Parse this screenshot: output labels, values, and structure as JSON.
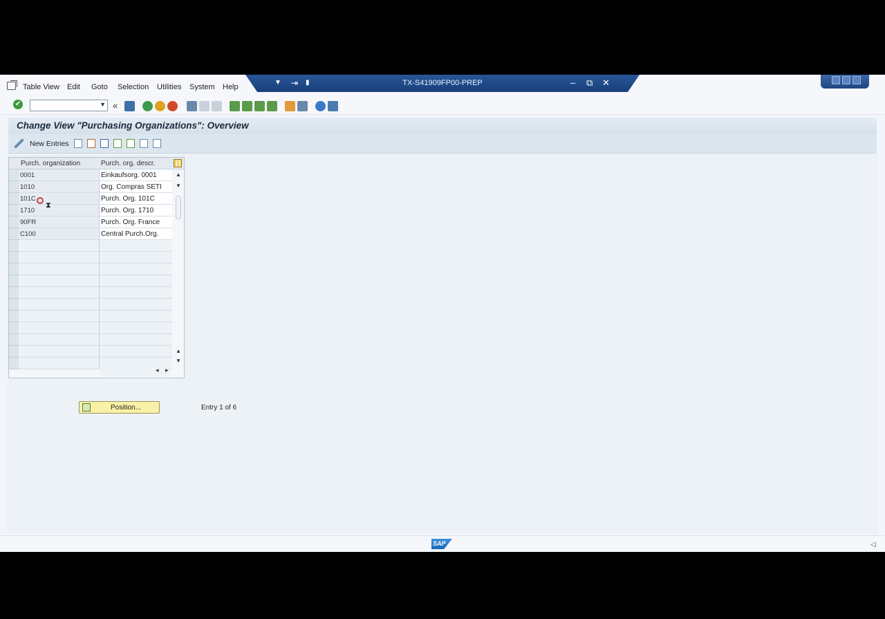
{
  "menubar": {
    "items": [
      "Table View",
      "Edit",
      "Goto",
      "Selection",
      "Utilities",
      "System",
      "Help"
    ],
    "underline_letters": [
      "T",
      "E",
      "G",
      "l",
      "U",
      "S",
      "H"
    ]
  },
  "titlebar": {
    "title": "TX-S41909FP00-PREP",
    "minimize": "–",
    "restore": "⧉",
    "close": "✕"
  },
  "toolbar": {
    "ok_glyph": "✔",
    "command_value": "",
    "back_glyph": "«"
  },
  "header": {
    "title": "Change View \"Purchasing Organizations\": Overview"
  },
  "app_toolbar": {
    "new_entries": "New Entries"
  },
  "table": {
    "columns": [
      "Purch. organization",
      "Purch. org. descr."
    ],
    "rows": [
      {
        "org": "0001",
        "descr": "Einkaufsorg. 0001"
      },
      {
        "org": "1010",
        "descr": "Org. Compras SETI"
      },
      {
        "org": "101C",
        "descr": "Purch. Org. 101C"
      },
      {
        "org": "1710",
        "descr": "Purch. Org. 1710"
      },
      {
        "org": "90FR",
        "descr": "Purch. Org. France"
      },
      {
        "org": "C100",
        "descr": "Central Purch.Org."
      }
    ],
    "empty_rows": 11
  },
  "footer": {
    "position_label": "Position...",
    "entry_text": "Entry 1 of 6"
  },
  "status": {
    "sap_logo": "SAP"
  },
  "colors": {
    "title_bar": "#1f4a8a",
    "header_bg": "#dce6ef",
    "position_button": "#f8f1a6"
  }
}
